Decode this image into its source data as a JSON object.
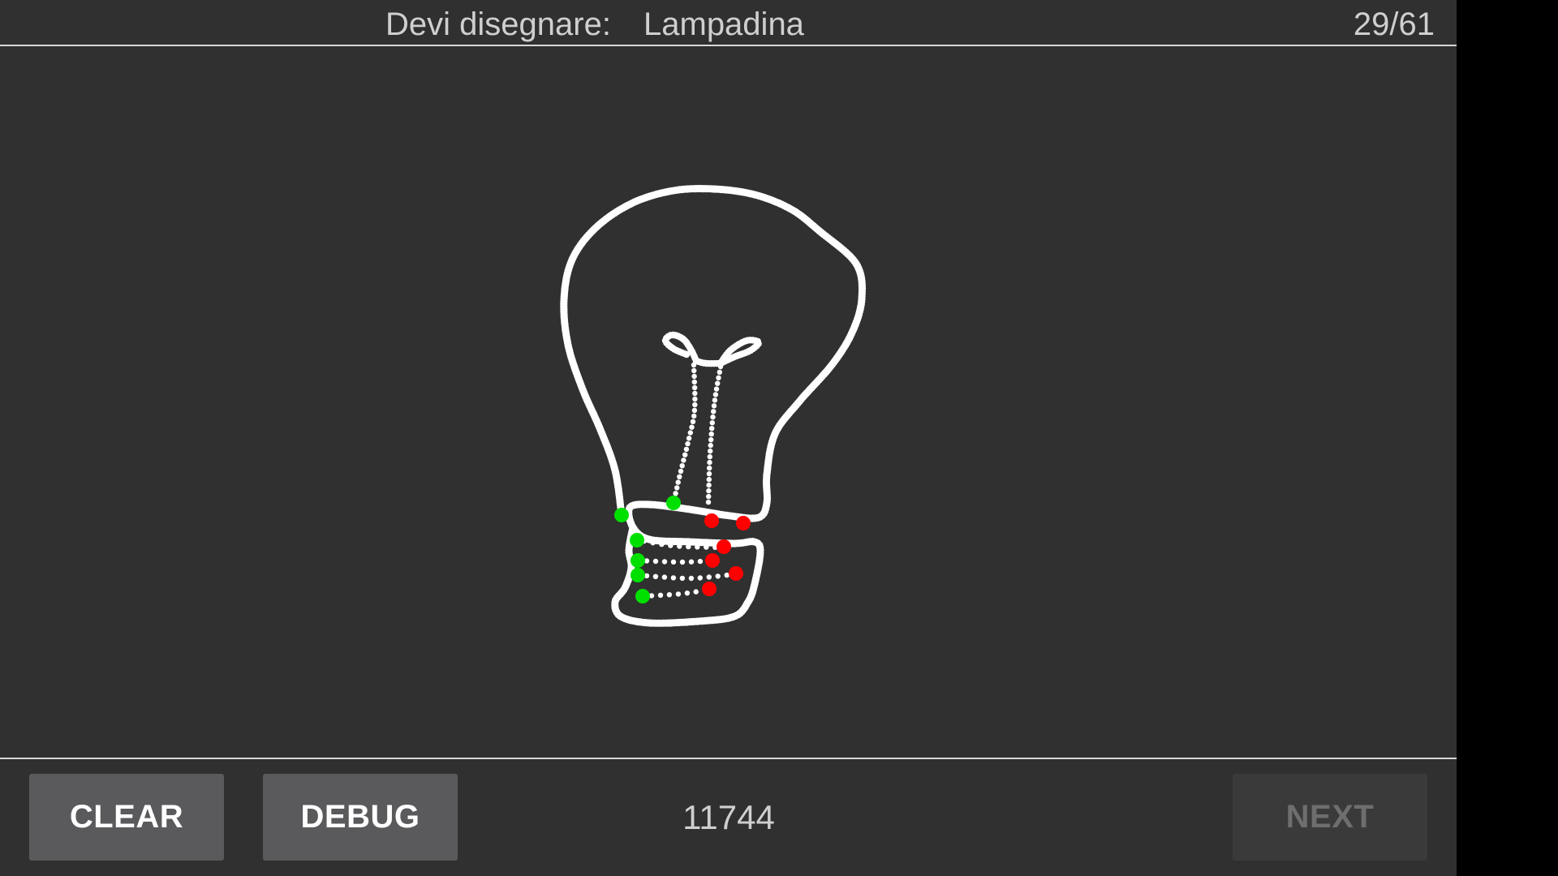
{
  "header": {
    "prompt_label": "Devi disegnare:",
    "prompt_word": "Lampadina",
    "progress": "29/61"
  },
  "footer": {
    "clear_label": "CLEAR",
    "debug_label": "DEBUG",
    "score": "11744",
    "next_label": "NEXT"
  },
  "colors": {
    "background": "#303030",
    "stroke": "#ffffff",
    "start_marker": "#00e000",
    "end_marker": "#ff0000"
  },
  "drawing": {
    "subject": "light-bulb sketch made of dotted strokes",
    "stroke_count": 8
  }
}
